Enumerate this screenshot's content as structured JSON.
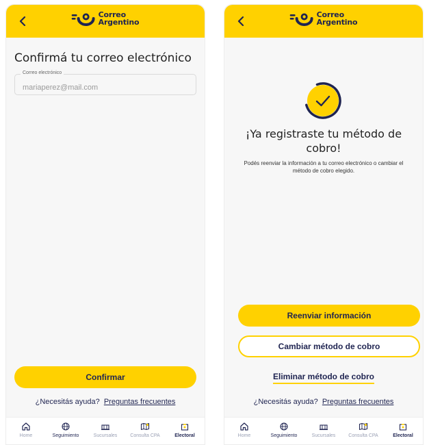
{
  "brand": {
    "line1": "Correo",
    "line2": "Argentino",
    "accent": "#ffd100",
    "navy": "#1f2451"
  },
  "screen1": {
    "title": "Confirmá tu correo electrónico",
    "email_field": {
      "label": "Correo electrónico",
      "value": "mariaperez@mail.com"
    },
    "confirm_label": "Confirmar"
  },
  "screen2": {
    "title": "¡Ya registraste tu método de cobro!",
    "subtitle": "Podés reenviar la información a tu correo electrónico o cambiar el método de cobro elegido.",
    "resend_label": "Reenviar información",
    "change_label": "Cambiar método de cobro",
    "delete_label": "Eliminar método de cobro"
  },
  "help": {
    "question": "¿Necesitás ayuda?",
    "link": "Preguntas frecuentes"
  },
  "tabbar": {
    "tabs": [
      {
        "label": "Home",
        "icon": "home-icon"
      },
      {
        "label": "Seguimiento",
        "icon": "globe-icon"
      },
      {
        "label": "Sucursales",
        "icon": "branch-icon"
      },
      {
        "label": "Consulta CPA",
        "icon": "map-icon"
      },
      {
        "label": "Electoral",
        "icon": "ballot-box-icon",
        "active": true
      }
    ]
  }
}
